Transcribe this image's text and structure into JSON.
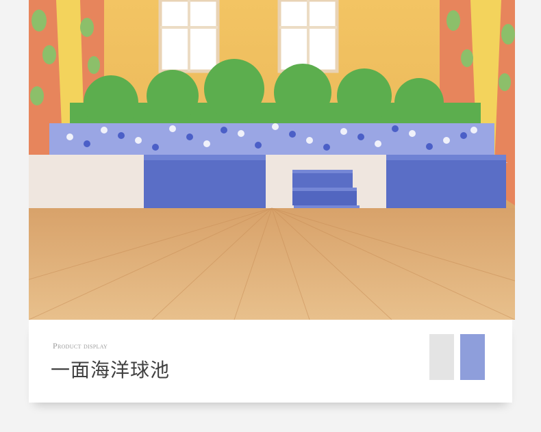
{
  "product": {
    "subtitle": "Product display",
    "title": "一面海洋球池"
  },
  "swatches": [
    {
      "name": "light-gray",
      "color": "#e4e4e4"
    },
    {
      "name": "periwinkle-blue",
      "color": "#8e9edb"
    }
  ],
  "photo": {
    "subject": "ball-pit-room"
  }
}
